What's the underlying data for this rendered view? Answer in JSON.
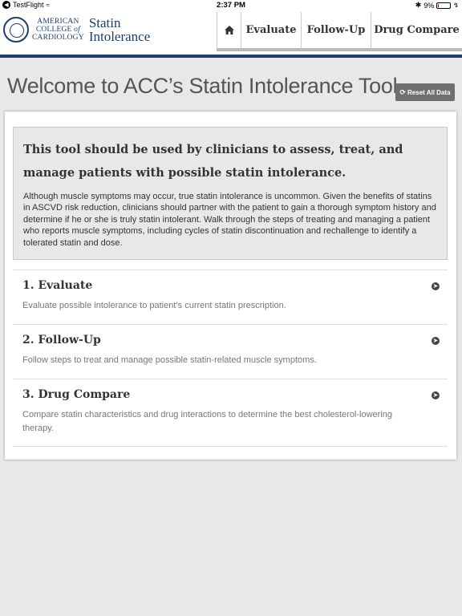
{
  "status_bar": {
    "back_app": "TestFlight",
    "time": "2:37 PM",
    "battery": "9%",
    "battery_level": 0.09
  },
  "logo": {
    "line1": "AMERICAN",
    "line2_a": "COLLEGE",
    "line2_b": "of",
    "line3": "CARDIOLOGY",
    "brand1": "Statin",
    "brand2": "Intolerance"
  },
  "nav": {
    "home_icon": "home-icon",
    "items": [
      {
        "label": "Evaluate"
      },
      {
        "label": "Follow-Up"
      },
      {
        "label": "Drug Compare"
      }
    ]
  },
  "page": {
    "title": "Welcome to ACC’s Statin Intolerance Tool",
    "reset_label": "Reset All Data"
  },
  "intro": {
    "heading": "This tool should be used by clinicians to assess, treat, and manage patients with possible statin intolerance.",
    "body": "Although muscle symptoms may occur, true statin intolerance is uncommon. Given the benefits of statins in ASCVD risk reduction, clinicians should partner with the patient to gain a thorough symptom history and determine if he or she is truly statin intolerant. Walk through the steps of treating and managing a patient who reports muscle symptoms, including cycles of statin discontinuation and rechallenge to identify a tolerated statin and dose."
  },
  "steps": [
    {
      "title": "1. Evaluate",
      "description": "Evaluate possible intolerance to patient’s current statin prescription."
    },
    {
      "title": "2. Follow-Up",
      "description": "Follow steps to treat and manage possible statin-related muscle symptoms."
    },
    {
      "title": "3. Drug Compare",
      "description": "Compare statin characteristics and drug interactions to determine the best cholesterol-lowering therapy."
    }
  ],
  "colors": {
    "brand": "#1c3f6e",
    "reset_button": "#6f6f6f",
    "background": "#e8e8e8"
  }
}
